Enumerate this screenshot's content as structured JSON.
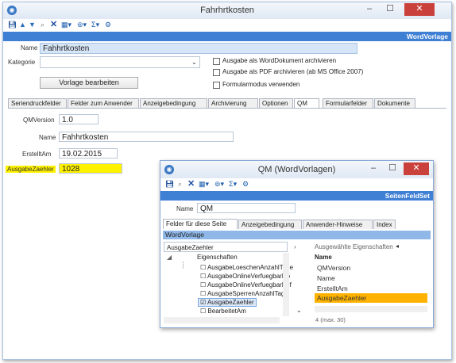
{
  "main_window": {
    "title": "Fahrhrtkosten",
    "banner": "WordVorlage",
    "name_label": "Name",
    "name_value": "Fahhrtkosten",
    "kategorie_label": "Kategorie",
    "kategorie_value": "",
    "edit_button": "Vorlage bearbeiten",
    "checkboxes": [
      {
        "label": "Ausgabe als WordDokument archivieren",
        "checked": false
      },
      {
        "label": "Ausgabe als PDF archivieren (ab MS Office 2007)",
        "checked": false
      },
      {
        "label": "Formularmodus verwenden",
        "checked": false
      }
    ],
    "tabs": [
      "Seriendruckfelder",
      "Felder zum Anwender",
      "Anzeigebedingung",
      "Archivierung",
      "Optionen",
      "QM",
      "Formularfelder",
      "Dokumente"
    ],
    "active_tab": "QM",
    "fields": {
      "qmversion_label": "QMVersion",
      "qmversion_value": "1.0",
      "name_label": "Name",
      "name_value": "Fahhrtkosten",
      "erstellt_label": "ErstelltAm",
      "erstellt_value": "19.02.2015",
      "ausgabe_label": "AusgabeZaehler",
      "ausgabe_value": "1028"
    },
    "window_buttons": {
      "minimize": "–",
      "maximize": "☐",
      "close": "✕"
    }
  },
  "dialog": {
    "title": "QM (WordVorlagen)",
    "banner": "SeitenFeldSet",
    "name_label": "Name",
    "name_value": "QM",
    "tabs": [
      "Felder für diese Seite",
      "Anzeigebedingung",
      "Anwender-Hinweise",
      "Index"
    ],
    "section": "WordVorlage",
    "search_value": "AusgabeZaehler",
    "selected_props_label": "Ausgewählte Eigenschaften",
    "tree_root": "Eigenschaften",
    "tree_items": [
      {
        "label": "AusgabeLoeschenAnzahlTage",
        "checked": false
      },
      {
        "label": "AusgabeOnlineVerfuegbarDo",
        "checked": false
      },
      {
        "label": "AusgabeOnlineVerfuegbarPdf",
        "checked": false
      },
      {
        "label": "AusgabeSperrenAnzahlTage",
        "checked": false
      },
      {
        "label": "AusgabeZaehler",
        "checked": true
      },
      {
        "label": "BearbeitetAm",
        "checked": false
      }
    ],
    "list_header": "Name",
    "list_items": [
      "QMVersion",
      "Name",
      "ErstelltAm",
      "AusgabeZaehler"
    ],
    "selected_item": "AusgabeZaehler",
    "count_text": "4 (max. 30)",
    "window_buttons": {
      "minimize": "–",
      "maximize": "☐",
      "close": "✕"
    }
  },
  "colors": {
    "accent": "#3f7fd4",
    "highlight": "#ffb300",
    "field_highlight": "#fff200"
  }
}
